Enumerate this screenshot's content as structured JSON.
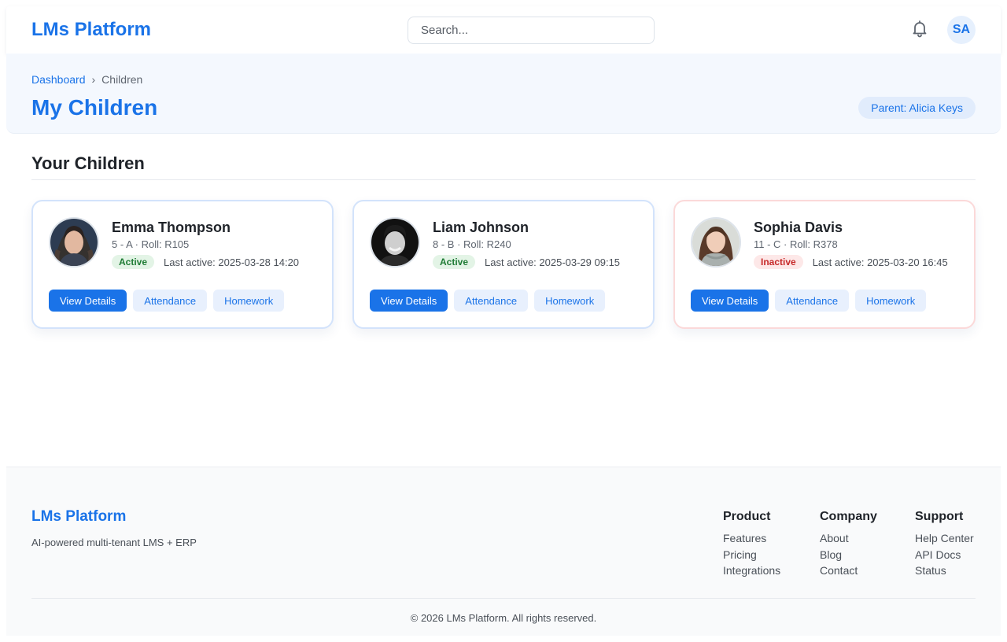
{
  "header": {
    "brand": "LMs Platform",
    "search_placeholder": "Search...",
    "avatar_initials": "SA",
    "notification_icon": "bell-icon"
  },
  "page": {
    "breadcrumb": {
      "home": "Dashboard",
      "separator": "›",
      "current": "Children"
    },
    "title": "My Children",
    "parent_badge": "Parent: Alicia Keys"
  },
  "section": {
    "title": "Your Children"
  },
  "children": [
    {
      "name": "Emma Thompson",
      "meta": "5 - A · Roll: R105",
      "status": "Active",
      "last_active": "Last active: 2025-03-28 14:20",
      "actions": {
        "details": "View Details",
        "attendance": "Attendance",
        "homework": "Homework"
      }
    },
    {
      "name": "Liam Johnson",
      "meta": "8 - B · Roll: R240",
      "status": "Active",
      "last_active": "Last active: 2025-03-29 09:15",
      "actions": {
        "details": "View Details",
        "attendance": "Attendance",
        "homework": "Homework"
      }
    },
    {
      "name": "Sophia Davis",
      "meta": "11 - C · Roll: R378",
      "status": "Inactive",
      "last_active": "Last active: 2025-03-20 16:45",
      "actions": {
        "details": "View Details",
        "attendance": "Attendance",
        "homework": "Homework"
      }
    }
  ],
  "footer": {
    "brand": "LMs Platform",
    "tagline": "AI-powered multi-tenant LMS + ERP",
    "columns": [
      {
        "title": "Product",
        "links": [
          "Features",
          "Pricing",
          "Integrations"
        ]
      },
      {
        "title": "Company",
        "links": [
          "About",
          "Blog",
          "Contact"
        ]
      },
      {
        "title": "Support",
        "links": [
          "Help Center",
          "API Docs",
          "Status"
        ]
      }
    ],
    "copyright": "© 2026 LMs Platform. All rights reserved."
  },
  "colors": {
    "primary": "#1a73e8",
    "active_bg": "#e3f4e6",
    "active_text": "#1e7b34",
    "inactive_bg": "#fde8e8",
    "inactive_text": "#c62828"
  }
}
